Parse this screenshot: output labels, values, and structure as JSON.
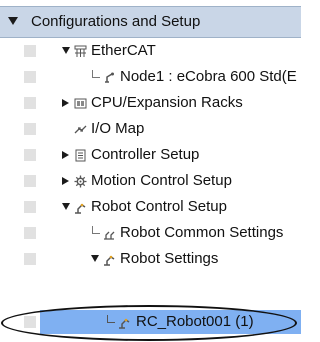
{
  "section": {
    "title": "Configurations and Setup"
  },
  "tree": [
    {
      "id": "ethercat",
      "label": "EtherCAT",
      "icon": "network-icon"
    },
    {
      "id": "node1",
      "label": "Node1 : eCobra 600 Std(E",
      "icon": "robot-node-icon"
    },
    {
      "id": "cpu",
      "label": "CPU/Expansion Racks",
      "icon": "rack-icon"
    },
    {
      "id": "iomap",
      "label": "I/O Map",
      "icon": "io-map-icon"
    },
    {
      "id": "controller",
      "label": "Controller Setup",
      "icon": "controller-icon"
    },
    {
      "id": "motion",
      "label": "Motion Control Setup",
      "icon": "motion-gear-icon"
    },
    {
      "id": "robotcontrol",
      "label": "Robot Control Setup",
      "icon": "robot-arm-icon"
    },
    {
      "id": "robotcommon",
      "label": "Robot Common Settings",
      "icon": "robot-common-icon"
    },
    {
      "id": "robotsettings",
      "label": "Robot Settings",
      "icon": "robot-arm-icon"
    },
    {
      "id": "rcrobot",
      "label": "RC_Robot001 (1)",
      "icon": "robot-arm-icon",
      "selected": true
    }
  ],
  "colors": {
    "header_bg": "#c9d6e7",
    "selected_bg": "#7fb0f2",
    "gutter": "#e1e1e1"
  }
}
